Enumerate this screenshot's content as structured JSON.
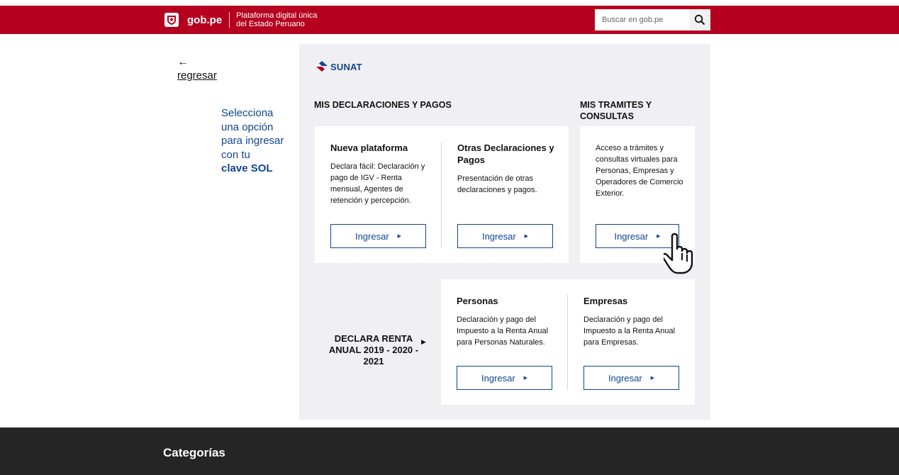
{
  "header": {
    "brand_name": "gob.pe",
    "tagline_line1": "Plataforma digital única",
    "tagline_line2": "del Estado Peruano",
    "search_placeholder": "Buscar en gob.pe"
  },
  "back": {
    "label": "regresar"
  },
  "intro": {
    "text": "Selecciona una opción para ingresar con tu",
    "strong": "clave SOL"
  },
  "logo": {
    "text": "SUNAT"
  },
  "declaraciones": {
    "title": "MIS DECLARACIONES Y PAGOS",
    "cols": [
      {
        "title": "Nueva plataforma",
        "desc": "Declara fácil: Declaración y pago de IGV - Renta mensual, Agentes de retención y percepción.",
        "button": "Ingresar"
      },
      {
        "title": "Otras Declaraciones y Pagos",
        "desc": "Presentación de otras declaraciones y pagos.",
        "button": "Ingresar"
      }
    ]
  },
  "tramites": {
    "title": "MIS TRAMITES Y CONSULTAS",
    "desc": "Acceso a trámites y consultas virtuales para Personas, Empresas y Operadores de Comercio Exterior.",
    "button": "Ingresar"
  },
  "renta": {
    "title": "DECLARA RENTA ANUAL 2019 - 2020 - 2021",
    "cols": [
      {
        "title": "Personas",
        "desc": "Declaración y pago del Impuesto a la Renta Anual para Personas Naturales.",
        "button": "Ingresar"
      },
      {
        "title": "Empresas",
        "desc": "Declaración y pago del Impuesto a la Renta Anual para Empresas.",
        "button": "Ingresar"
      }
    ]
  },
  "footer": {
    "title": "Categorías"
  },
  "colors": {
    "header": "#b5011f",
    "accent": "#12458f",
    "panel": "#f0f0f4",
    "footer": "#252525"
  },
  "icons": [
    "shield-icon",
    "search-icon",
    "arrow-left-icon",
    "sunat-logo-icon",
    "triangle-right-icon",
    "hand-cursor-icon"
  ]
}
